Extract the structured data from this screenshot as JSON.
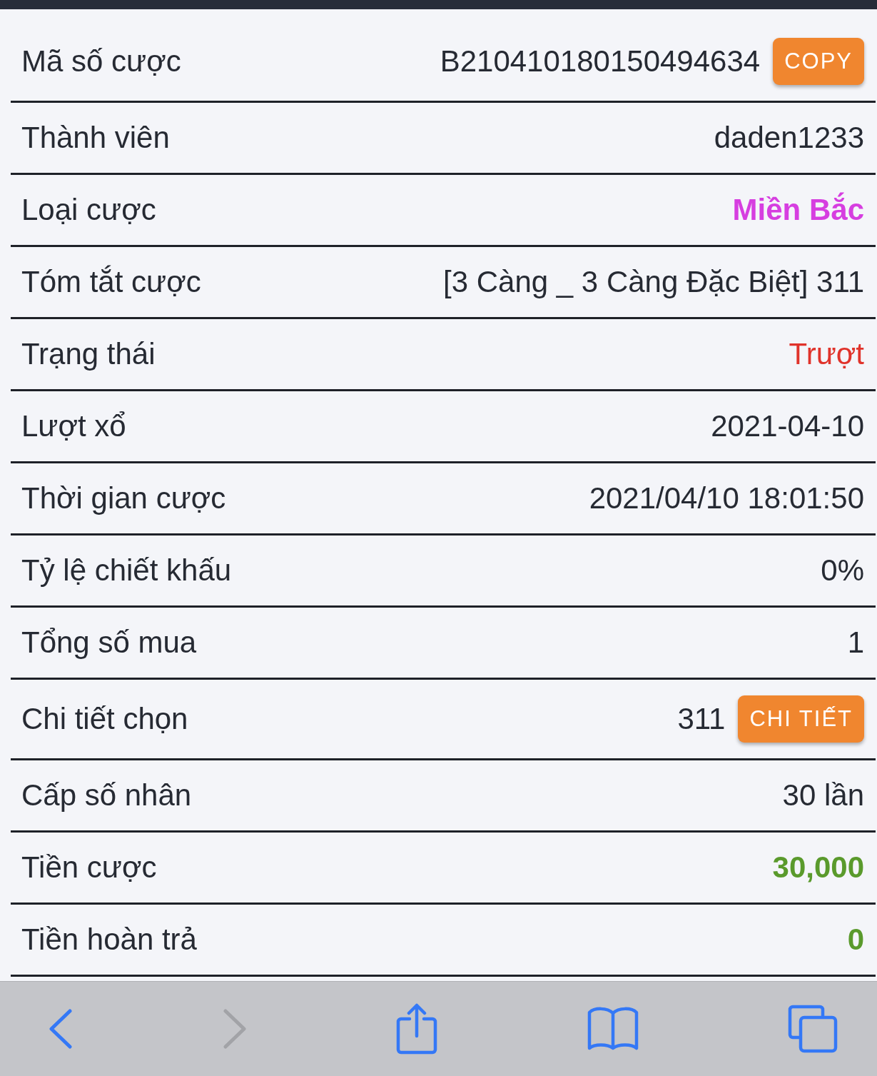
{
  "details": {
    "rows": [
      {
        "label": "Mã số cược",
        "value": "B210410180150494634",
        "kind": "plain",
        "button": "COPY"
      },
      {
        "label": "Thành viên",
        "value": "daden1233",
        "kind": "plain"
      },
      {
        "label": "Loại cược",
        "value": "Miền Bắc",
        "kind": "strong",
        "color": "#d63ee0"
      },
      {
        "label": "Tóm tắt cược",
        "value": "[3 Càng _ 3 Càng Đặc Biệt] 311",
        "kind": "plain"
      },
      {
        "label": "Trạng thái",
        "value": "Trượt",
        "kind": "status",
        "color": "#e0332b"
      },
      {
        "label": "Lượt xổ",
        "value": "2021-04-10",
        "kind": "plain"
      },
      {
        "label": "Thời gian cược",
        "value": "2021/04/10 18:01:50",
        "kind": "plain"
      },
      {
        "label": "Tỷ lệ chiết khấu",
        "value": "0%",
        "kind": "plain"
      },
      {
        "label": "Tổng số mua",
        "value": "1",
        "kind": "plain"
      },
      {
        "label": "Chi tiết chọn",
        "value": "311",
        "kind": "plain",
        "button": "CHI TIẾT"
      },
      {
        "label": "Cấp số nhân",
        "value": "30 lần",
        "kind": "plain"
      },
      {
        "label": "Tiền cược",
        "value": "30,000",
        "kind": "strong",
        "color": "#5a9a2c"
      },
      {
        "label": "Tiền hoàn trả",
        "value": "0",
        "kind": "strong",
        "color": "#5a9a2c"
      }
    ]
  },
  "browser_toolbar": {
    "buttons": [
      {
        "kind": "back",
        "disabled": false
      },
      {
        "kind": "forward",
        "disabled": true
      },
      {
        "kind": "share",
        "disabled": false
      },
      {
        "kind": "bookmarks",
        "disabled": false
      },
      {
        "kind": "tabs",
        "disabled": false
      }
    ]
  }
}
